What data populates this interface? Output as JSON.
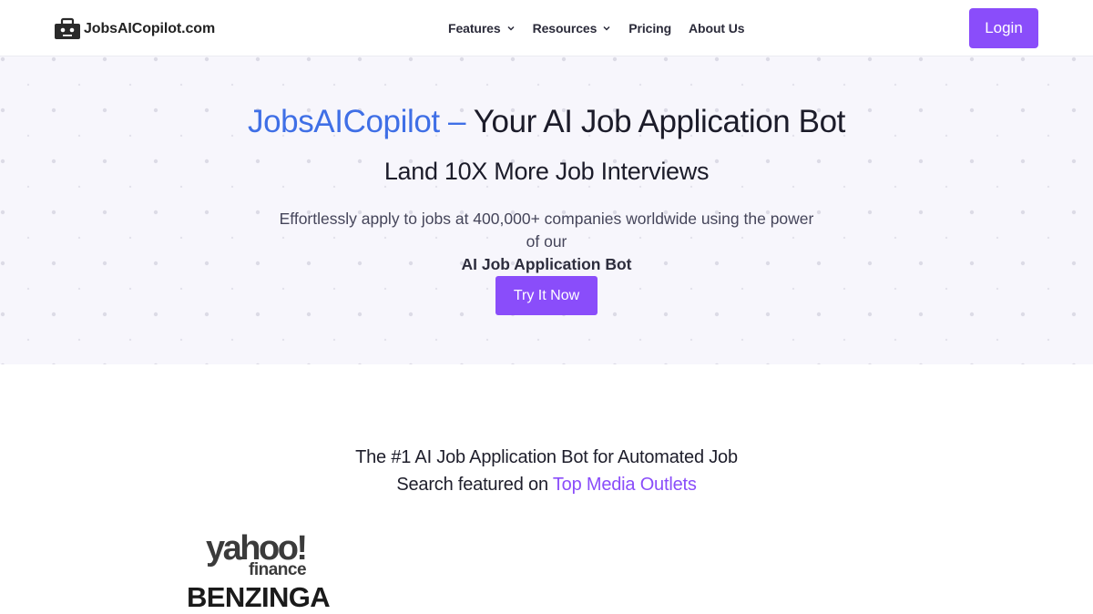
{
  "header": {
    "logo_text": "JobsAICopilot.com",
    "menu": [
      {
        "label": "Features",
        "has_dropdown": true
      },
      {
        "label": "Resources",
        "has_dropdown": true
      },
      {
        "label": "Pricing",
        "has_dropdown": false
      },
      {
        "label": "About Us",
        "has_dropdown": false
      }
    ],
    "login_label": "Login"
  },
  "hero": {
    "title_brand": "JobsAICopilot –",
    "title_rest": " Your AI Job Application Bot",
    "subtitle": "Land 10X More Job Interviews",
    "description": "Effortlessly apply to jobs at 400,000+ companies worldwide using the power of our",
    "description_bold": "AI Job Application Bot",
    "cta_label": "Try It Now"
  },
  "media": {
    "heading_line1": "The #1 AI Job Application Bot for Automated Job",
    "heading_line2": "Search featured on ",
    "heading_accent": "Top Media Outlets",
    "logos": {
      "yahoo_word": "yahoo!",
      "yahoo_sub": "finance",
      "benzinga": "BENZINGA"
    }
  },
  "colors": {
    "accent": "#8a4dfa",
    "brand_blue": "#3f6fe6",
    "hero_bg": "#f7f6fc"
  },
  "icons": [
    "robot-briefcase-icon",
    "chevron-down-icon"
  ]
}
